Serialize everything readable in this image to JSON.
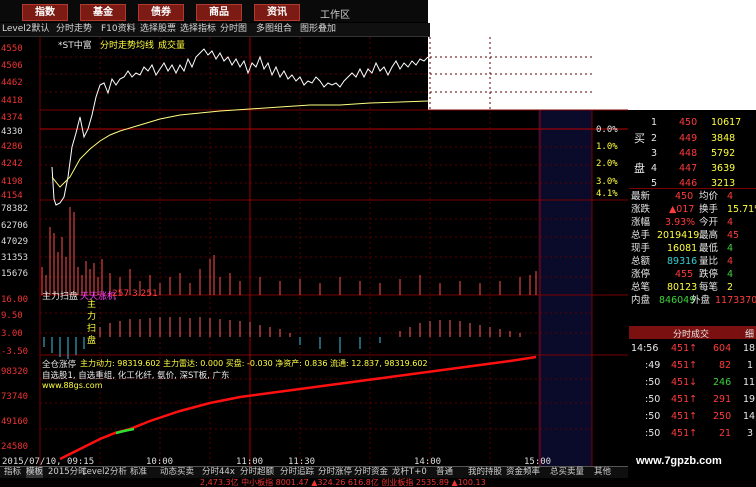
{
  "top_tabs": [
    "指数",
    "基金",
    "债券",
    "商品",
    "资讯"
  ],
  "workspace_label": "工作区",
  "toolbar": [
    "Level2默认",
    "分时走势",
    "F10资料",
    "选择股票",
    "选择指标",
    "分时图",
    "多图组合",
    "图形叠加"
  ],
  "chart_header": {
    "stock": "*ST中富",
    "tabs": [
      "分时走势",
      "均线",
      "成交量"
    ]
  },
  "price_axis": [
    "4550",
    "4506",
    "4462",
    "4418",
    "4374",
    "4330",
    "4286",
    "4242",
    "4198",
    "4154"
  ],
  "pct_axis": [
    "0.0%",
    "1.0%",
    "2.0%",
    "3.0%",
    "4.1%"
  ],
  "volume_axis": [
    "78382",
    "62706",
    "47029",
    "31353",
    "15676"
  ],
  "indicator_label": "主力扫盘",
  "indicator_text": "天天涨机",
  "indicator_values": "257  3.251",
  "indicator_axis": [
    "16.00",
    "9.50",
    "3.00",
    "-3.50"
  ],
  "vertical_marks": [
    "主",
    "力",
    "扫",
    "盘"
  ],
  "fund_label": "全仓涨停",
  "fund_text": "主力动力: 98319.602 主力雷达: 0.000 买盘: -0.030 净资产: 0.836 流通: 12.837, 98319.602",
  "fund_axis": [
    "98320",
    "73740",
    "49160",
    "24580"
  ],
  "concepts": "自选股1, 自选重组, 化工化纤, 氨价, 深ST板, 广东",
  "website_small": "www.88gs.com",
  "time_axis": [
    "2015/07/10, 09:15",
    "10:00",
    "11:00",
    "11:30",
    "14:00",
    "15:00"
  ],
  "orderbook": {
    "buy_label": [
      "买",
      "盘"
    ],
    "rows": [
      {
        "n": "1",
        "p": "450",
        "v": "10617"
      },
      {
        "n": "2",
        "p": "449",
        "v": "3848"
      },
      {
        "n": "3",
        "p": "448",
        "v": "5792"
      },
      {
        "n": "4",
        "p": "447",
        "v": "3639"
      },
      {
        "n": "5",
        "p": "446",
        "v": "3213"
      }
    ]
  },
  "stats": [
    {
      "k1": "最新",
      "v1": "450",
      "k2": "均价",
      "v2": "4"
    },
    {
      "k1": "涨跌",
      "v1": "▲017",
      "k2": "换手",
      "v2": "15.71%"
    },
    {
      "k1": "涨幅",
      "v1": "3.93%",
      "k2": "今开",
      "v2": "4"
    },
    {
      "k1": "总手",
      "v1": "2019419",
      "k2": "最高",
      "v2": "45"
    },
    {
      "k1": "现手",
      "v1": "16081",
      "k2": "最低",
      "v2": "4"
    },
    {
      "k1": "总额",
      "v1": "89316",
      "k2": "量比",
      "v2": "4"
    },
    {
      "k1": "涨停",
      "v1": "455",
      "k2": "跌停",
      "v2": "4"
    },
    {
      "k1": "总笔",
      "v1": "80123",
      "k2": "每笔",
      "v2": "2"
    },
    {
      "k1": "内盘",
      "v1": "846049",
      "k2": "外盘",
      "v2": "1173370"
    }
  ],
  "ticks_title": "分时成交",
  "ticks_extra": "细",
  "ticks": [
    {
      "t": "14:56",
      "p": "451↑",
      "v": "604",
      "n": "18"
    },
    {
      "t": ":49",
      "p": "451↑",
      "v": "82",
      "n": "1"
    },
    {
      "t": ":50",
      "p": "451↓",
      "v": "246",
      "n": "11"
    },
    {
      "t": ":50",
      "p": "451↑",
      "v": "291",
      "n": "19"
    },
    {
      "t": ":50",
      "p": "451↑",
      "v": "250",
      "n": "14"
    },
    {
      "t": ":50",
      "p": "451↑",
      "v": "21",
      "n": "3"
    }
  ],
  "bottom_tabs": [
    "指标",
    "模板",
    "2015分时",
    "Level2分析",
    "标准",
    "动态买卖",
    "分时44x",
    "分时超额",
    "分时追踪",
    "分时涨停",
    "分时资金",
    "龙杆T+0",
    "普通",
    "我的持股",
    "资金频率",
    "总买卖量",
    "其他"
  ],
  "status_text": "2,473.3亿  中小板指  8001.47  ▲324.26  616.8亿  创业板指  2535.89  ▲100.13",
  "watermark": "www.7gpzb.com",
  "colors": {
    "up": "#ff3b3b",
    "down": "#3bd33b",
    "price_line": "#ffffff",
    "avg_line": "#ffff80",
    "grid": "#7a0000"
  }
}
